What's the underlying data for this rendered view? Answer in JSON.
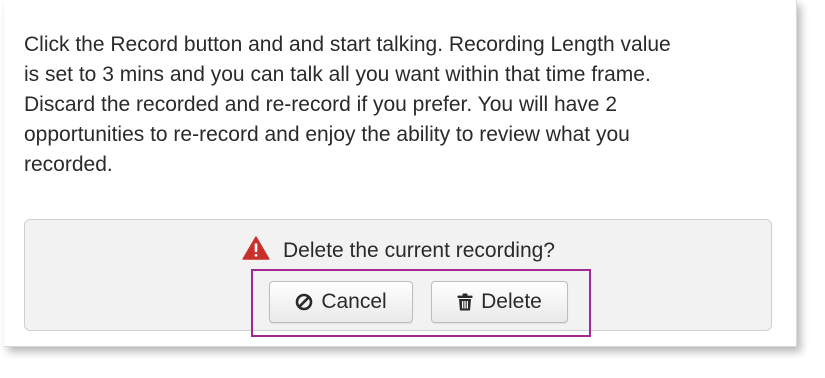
{
  "instructions": {
    "line1": "Click the Record button and and start talking. Recording Length value",
    "line2": "is set to 3 mins and you can talk all you want within that time frame.",
    "line3": "Discard the recorded and re-record if you prefer. You will have 2",
    "line4": "opportunities to re-record and enjoy the ability to review what you",
    "line5": "recorded."
  },
  "confirm": {
    "icon": "warning-icon",
    "prompt": "Delete the current recording?",
    "cancel_label": "Cancel",
    "cancel_icon": "ban-icon",
    "delete_label": "Delete",
    "delete_icon": "trash-icon"
  },
  "colors": {
    "warning": "#c9302c",
    "highlight": "#a3288f",
    "panel_bg": "#f2f2f2"
  }
}
